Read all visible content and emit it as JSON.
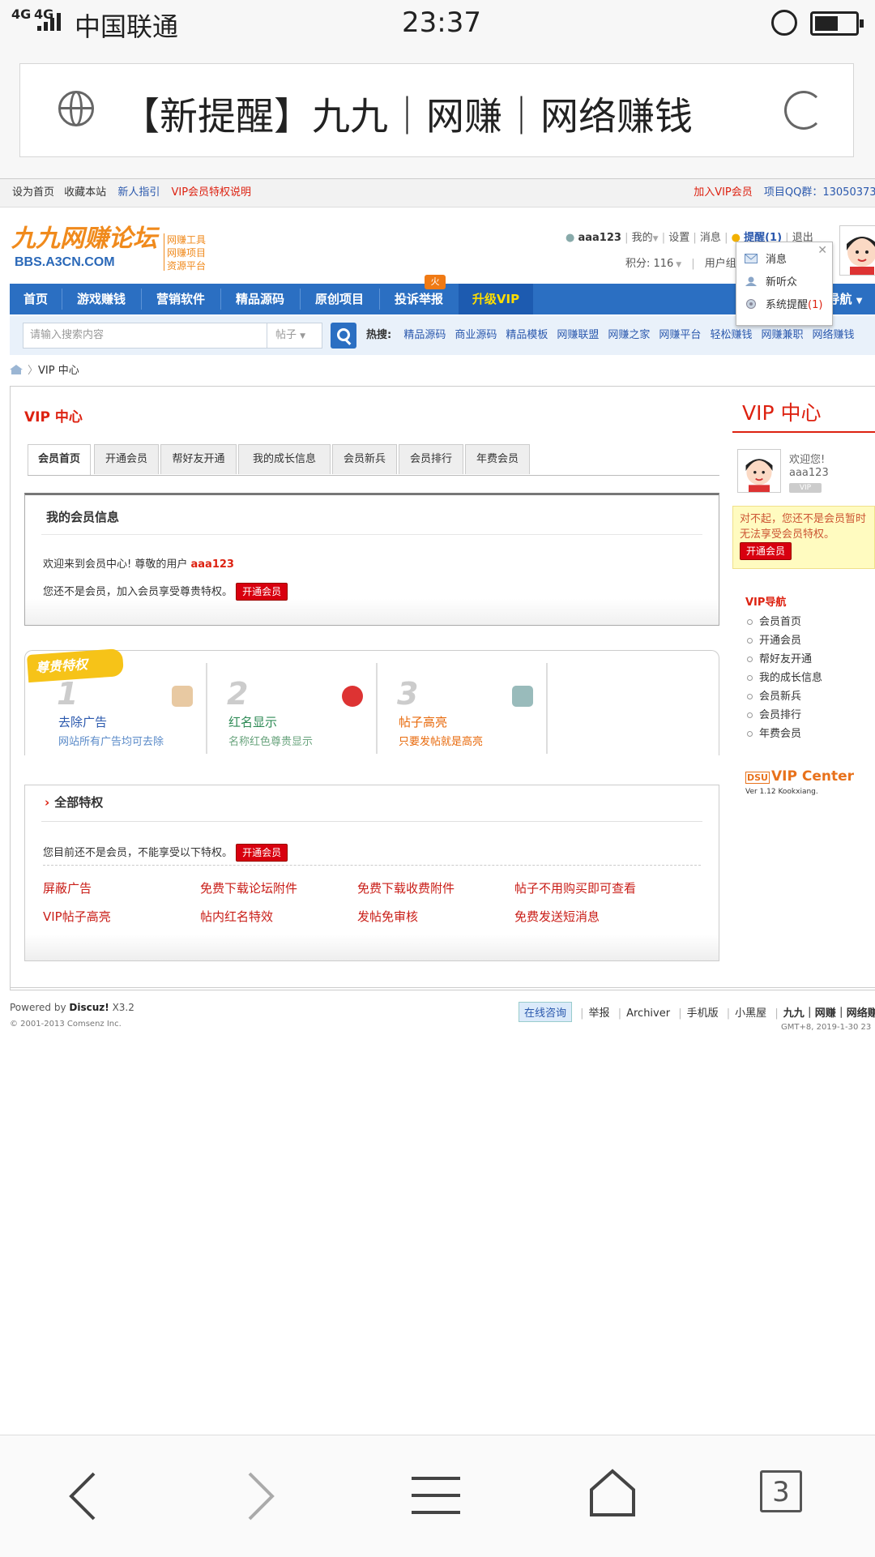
{
  "status_bar": {
    "signal": "4G",
    "carrier": "中国联通",
    "time": "23:37"
  },
  "browser": {
    "title": "【新提醒】九九｜网赚｜网络赚钱",
    "tab_count": "3"
  },
  "top_strip": {
    "left": [
      "设为首页",
      "收藏本站"
    ],
    "guide": "新人指引",
    "vip_desc": "VIP会员特权说明",
    "join_vip": "加入VIP会员",
    "qq_group": "项目QQ群：13050373"
  },
  "logo": {
    "cn": "九九网赚论坛",
    "domain": "BBS.A3CN.COM",
    "tags": [
      "网赚工具",
      "网赚项目",
      "资源平台"
    ]
  },
  "user_bar": {
    "username": "aaa123",
    "items": [
      "我的",
      "设置",
      "消息"
    ],
    "reminder": "提醒(1)",
    "logout": "退出",
    "points": "积分: 116",
    "usergroup": "用户组"
  },
  "reminder_popup": {
    "items": [
      "消息",
      "新听众",
      "系统提醒"
    ],
    "system_count": "(1)"
  },
  "nav": {
    "items": [
      "首页",
      "游戏赚钱",
      "营销软件",
      "精品源码",
      "原创项目",
      "投诉举报"
    ],
    "vip": "升级VIP",
    "hot": "火",
    "right": "导航"
  },
  "search": {
    "placeholder": "请输入搜索内容",
    "type": "帖子",
    "hot_label": "热搜:",
    "hot_words": [
      "精品源码",
      "商业源码",
      "精品模板",
      "网赚联盟",
      "网赚之家",
      "网赚平台",
      "轻松赚钱",
      "网赚兼职",
      "网络赚钱"
    ]
  },
  "breadcrumb": {
    "current": "VIP 中心"
  },
  "main": {
    "title": "VIP 中心",
    "tabs": [
      "会员首页",
      "开通会员",
      "帮好友开通",
      "我的成长信息",
      "会员新兵",
      "会员排行",
      "年费会员"
    ],
    "info_box": {
      "title": "我的会员信息",
      "welcome": "欢迎来到会员中心! 尊敬的用户",
      "username": "aaa123",
      "not_member": "您还不是会员，加入会员享受尊贵特权。",
      "open_btn": "开通会员"
    },
    "privileges": {
      "ribbon": "尊贵特权",
      "cards": [
        {
          "num": "1",
          "title": "去除广告",
          "desc": "网站所有广告均可去除",
          "color": "#2a58ad"
        },
        {
          "num": "2",
          "title": "红名显示",
          "desc": "名称红色尊贵显示",
          "color": "#2d8a55"
        },
        {
          "num": "3",
          "title": "帖子高亮",
          "desc": "只要发帖就是高亮",
          "color": "#e86a0c"
        }
      ]
    },
    "all_privileges": {
      "title": "全部特权",
      "note": "您目前还不是会员，不能享受以下特权。",
      "open_btn": "开通会员",
      "items": [
        "屏蔽广告",
        "免费下载论坛附件",
        "免费下载收费附件",
        "帖子不用购买即可查看",
        "VIP帖子高亮",
        "帖内红名特效",
        "发帖免审核",
        "免费发送短消息"
      ]
    }
  },
  "sidebar": {
    "title": "VIP 中心",
    "welcome": "欢迎您!",
    "username": "aaa123",
    "vip_badge": "VIP",
    "warning": "对不起，您还不是会员暂时无法享受会员特权。",
    "open_btn": "开通会员",
    "nav_title": "VIP导航",
    "nav_items": [
      "会员首页",
      "开通会员",
      "帮好友开通",
      "我的成长信息",
      "会员新兵",
      "会员排行",
      "年费会员"
    ],
    "center_tag": "DSU",
    "center_name": "VIP Center",
    "version": "Ver 1.12 Kookxiang."
  },
  "footer": {
    "powered_prefix": "Powered by",
    "powered_name": "Discuz!",
    "powered_ver": "X3.2",
    "copyright": "© 2001-2013 Comsenz Inc.",
    "consult": "在线咨询",
    "links": [
      "举报",
      "Archiver",
      "手机版",
      "小黑屋"
    ],
    "site": "九九｜网赚｜网络赚",
    "gmt": "GMT+8, 2019-1-30 23"
  }
}
